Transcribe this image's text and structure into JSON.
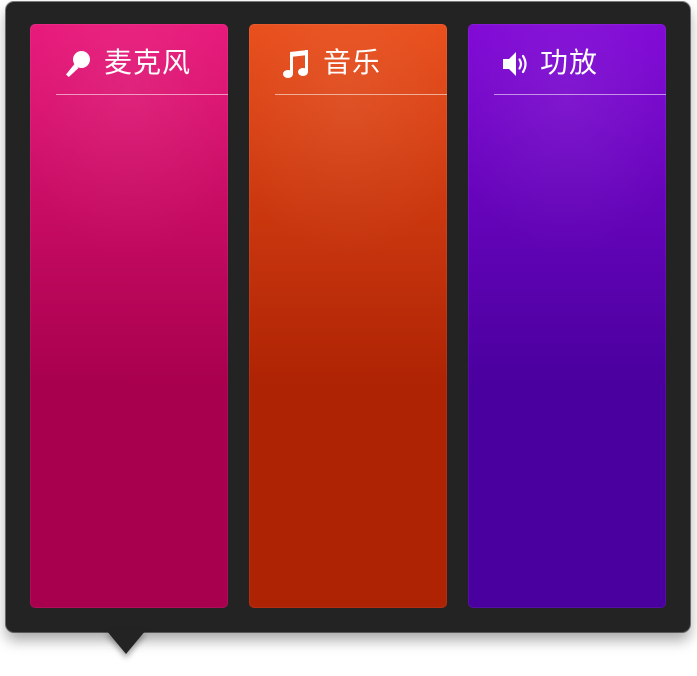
{
  "channels": [
    {
      "title": "麦克风",
      "icon": "microphone-icon",
      "gradient": {
        "top": "#e8187a",
        "bottom": "#a8004e"
      }
    },
    {
      "title": "音乐",
      "icon": "music-note-icon",
      "gradient": {
        "top": "#e94e1b",
        "bottom": "#ae2304"
      }
    },
    {
      "title": "功放",
      "icon": "speaker-icon",
      "gradient": {
        "top": "#8108d6",
        "bottom": "#4a009e"
      }
    }
  ]
}
